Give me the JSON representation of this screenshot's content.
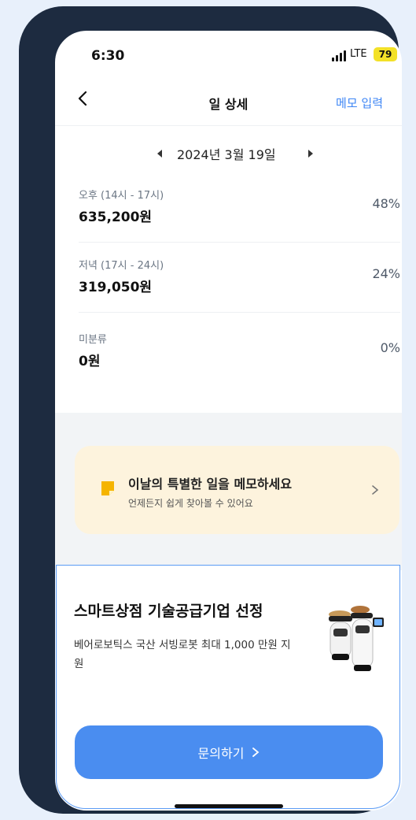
{
  "status_bar": {
    "time": "6:30",
    "network": "LTE",
    "battery": "79"
  },
  "nav": {
    "title": "일 상세",
    "memo_link": "메모 입력"
  },
  "date": {
    "label": "2024년 3월 19일"
  },
  "breakdown": [
    {
      "label": "오후 (14시 - 17시)",
      "amount": "635,200원",
      "percent": "48%"
    },
    {
      "label": "저녁 (17시 - 24시)",
      "amount": "319,050원",
      "percent": "24%"
    },
    {
      "label": "미분류",
      "amount": "0원",
      "percent": "0%"
    }
  ],
  "memo_card": {
    "title": "이날의 특별한 일을 메모하세요",
    "subtitle": "언제든지 쉽게 찾아볼 수 있어요"
  },
  "promo": {
    "title": "스마트상점 기술공급기업 선정",
    "description": "베어로보틱스 국산 서빙로봇 최대 1,000 만원 지원",
    "cta_label": "문의하기"
  },
  "colors": {
    "accent": "#4a8df0",
    "link": "#3e86f5",
    "memo_bg": "#fdf3dd",
    "memo_icon": "#f5b400",
    "frame": "#1d2b40"
  },
  "icons": [
    "back-chevron-icon",
    "caret-left-icon",
    "caret-right-icon",
    "memo-note-icon",
    "chevron-right-icon",
    "serving-robot-image"
  ]
}
